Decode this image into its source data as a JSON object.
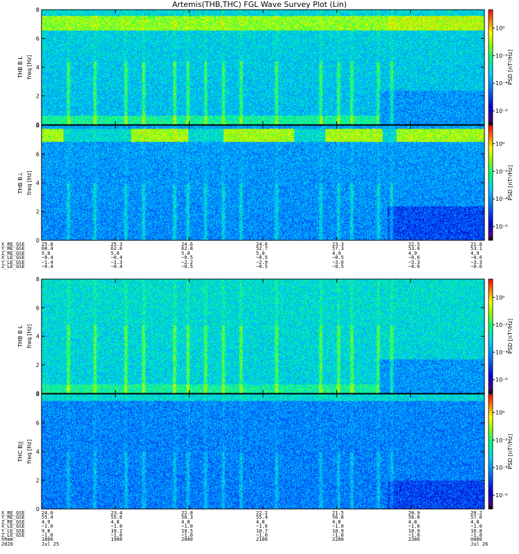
{
  "title": "Artemis(THB,THC) FGL Wave Survey Plot (Lin)",
  "chart_data": [
    {
      "type": "heatmap",
      "id": "p1",
      "panel_label": "THB B L",
      "ylabel": "freq [Hz]",
      "ylim": [
        0,
        8
      ],
      "yticks": [
        0,
        2,
        4,
        6,
        8
      ],
      "colorbar_label": "PSD [nT²/Hz]",
      "colorbar_ticks": [
        "10⁰",
        "10⁻²",
        "10⁻⁴",
        "10⁻⁶"
      ]
    },
    {
      "type": "heatmap",
      "id": "p2",
      "panel_label": "THB B⊥",
      "ylabel": "freq [Hz]",
      "ylim": [
        0,
        8
      ],
      "yticks": [
        0,
        2,
        4,
        6,
        8
      ],
      "colorbar_label": "PSD [nT²/Hz]",
      "colorbar_ticks": [
        "10⁰",
        "10⁻²",
        "10⁻⁴",
        "10⁻⁶"
      ]
    },
    {
      "type": "heatmap",
      "id": "p3",
      "panel_label": "THB B L",
      "ylabel": "freq [Hz]",
      "ylim": [
        0,
        8
      ],
      "yticks": [
        0,
        2,
        4,
        6,
        8
      ],
      "colorbar_label": "PSD [nT²/Hz]",
      "colorbar_ticks": [
        "10⁰",
        "10⁻²",
        "10⁻⁴",
        "10⁻⁶"
      ]
    },
    {
      "type": "heatmap",
      "id": "p4",
      "panel_label": "THC B||",
      "ylabel": "freq [Hz]",
      "ylim": [
        0,
        8
      ],
      "yticks": [
        0,
        2,
        4,
        6,
        8
      ],
      "colorbar_label": "PSD [nT²/Hz]",
      "colorbar_ticks": [
        "10⁰",
        "10⁻²",
        "10⁻⁴",
        "10⁻⁶"
      ]
    }
  ],
  "ephemeris_top": {
    "rows": [
      {
        "name": "X_RE_GSE",
        "values": [
          "25.8",
          "25.3",
          "24.6",
          "24.0",
          "23.3",
          "22.5",
          "21.8"
        ]
      },
      {
        "name": "Y_RE_GSE",
        "values": [
          "60.4",
          "62.0",
          "62.8",
          "52.7",
          "57.3",
          "53.0",
          "53.1"
        ]
      },
      {
        "name": "Z_RE_GSE",
        "values": "5.0 / 5.0 / 5.0 / 5.0 / 4.9 / 4.9 / 4.9"
      },
      {
        "name": "X_LE_GSE",
        "values": [
          "−0.4",
          "−0.4",
          "−0.5",
          "−0.5",
          "−0.5",
          "−0.6",
          "−0.6"
        ]
      },
      {
        "name": "Y_LE_GSE",
        "values": [
          "−1.4",
          "−1.3",
          "−2.2",
          "−2.9",
          "−3.0",
          "−3.3",
          "−3.3"
        ]
      },
      {
        "name": "Z_LE_GSE",
        "values": [
          "−0.4",
          "−0.4",
          "−0.5",
          "−0.5",
          "−0.5",
          "−0.6",
          "−0.6"
        ]
      }
    ]
  },
  "ephemeris_bottom": {
    "rows": [
      {
        "name": "X_RE_GSE",
        "values": [
          "24.0",
          "23.4",
          "22.8",
          "22.2",
          "21.5",
          "20.9",
          "20.2"
        ]
      },
      {
        "name": "Y_RE_GSE",
        "values": [
          "55.4",
          "55.6",
          "56.3",
          "55.4",
          "56.8",
          "56.8",
          "57.0"
        ]
      },
      {
        "name": "Z_RE_GSE",
        "values": [
          "4.9",
          "4.8",
          "4.8",
          "4.8",
          "4.8",
          "4.8",
          "4.8"
        ]
      },
      {
        "name": "X_LE_GSE",
        "values": [
          "−1.0",
          "−1.0",
          "−1.0",
          "−1.0",
          "−1.0",
          "−1.0",
          "−1.0"
        ]
      },
      {
        "name": "Y_LE_GSE",
        "values": [
          "9.8",
          "10.2",
          "10.5",
          "10.7",
          "10.9",
          "10.9",
          "10.8"
        ]
      },
      {
        "name": "Z_LE_GSE",
        "values": [
          "−1.0",
          "−1.0",
          "−1.0",
          "−1.0",
          "−1.0",
          "−1.0",
          "−1.0"
        ]
      },
      {
        "name": "hhmm",
        "values": [
          "1800",
          "1900",
          "2000",
          "2100",
          "2200",
          "2300",
          "0000"
        ]
      },
      {
        "name": "2020",
        "values": [
          "Jul 25",
          "",
          "",
          "",
          "",
          "",
          "Jul 26"
        ]
      }
    ]
  }
}
